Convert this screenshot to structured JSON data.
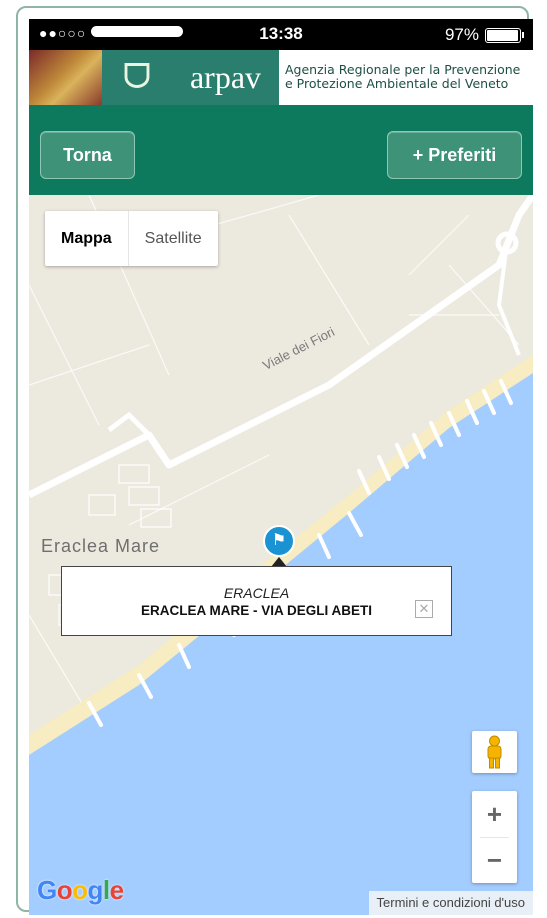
{
  "status_bar": {
    "signal": "●●○○○",
    "time": "13:38",
    "battery": "97%"
  },
  "header": {
    "logo_word": "arpav",
    "agency_line1": "Agenzia Regionale per la Prevenzione",
    "agency_line2": "e Protezione Ambientale del Veneto"
  },
  "nav": {
    "back_label": "Torna",
    "favorites_label": "+ Preferiti"
  },
  "map": {
    "type_map": "Mappa",
    "type_satellite": "Satellite",
    "road_label": "Viale dei Fiori",
    "place_label": "Eraclea Mare",
    "info": {
      "city": "ERACLEA",
      "station": "ERACLEA MARE - VIA DEGLI ABETI"
    },
    "zoom_in": "+",
    "zoom_out": "−",
    "google_logo": "Google",
    "terms": "Termini e condizioni d'uso"
  },
  "colors": {
    "nav_green": "#0d7a5e",
    "sea": "#a3ccff",
    "beach": "#f7ecc2",
    "pin": "#1b93d2"
  }
}
